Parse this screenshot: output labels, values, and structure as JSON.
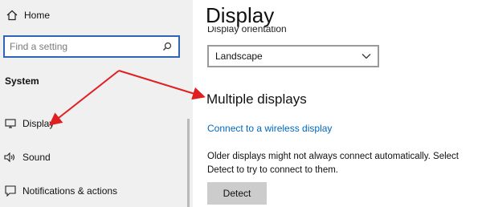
{
  "sidebar": {
    "home": {
      "label": "Home",
      "icon": "home-icon"
    },
    "search": {
      "placeholder": "Find a setting",
      "icon": "search-icon"
    },
    "section_label": "System",
    "items": [
      {
        "label": "Display",
        "icon": "monitor-icon"
      },
      {
        "label": "Sound",
        "icon": "speaker-icon"
      },
      {
        "label": "Notifications & actions",
        "icon": "notification-icon"
      }
    ]
  },
  "main": {
    "title": "Display",
    "orientation": {
      "label": "Display orientation",
      "value": "Landscape"
    },
    "multiple_displays": {
      "heading": "Multiple displays",
      "link": "Connect to a wireless display",
      "description": "Older displays might not always connect automatically. Select Detect to try to connect to them.",
      "detect_button": "Detect"
    }
  },
  "colors": {
    "sidebar_bg": "#f0f0f0",
    "search_border": "#2f64b6",
    "link": "#0067c0",
    "annotation_arrow": "#e02020",
    "button_bg": "#cccccc"
  }
}
